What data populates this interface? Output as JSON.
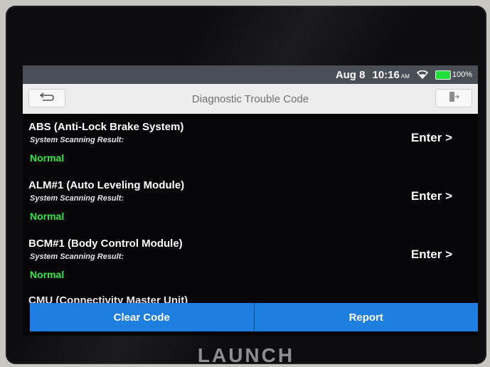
{
  "status": {
    "date": "Aug 8",
    "time": "10:16",
    "ampm": "AM",
    "battery": "100%",
    "wifi_icon": "wifi-icon",
    "battery_icon": "battery-icon"
  },
  "header": {
    "title": "Diagnostic Trouble Code",
    "back_icon": "back-arrow-icon",
    "exit_icon": "exit-icon"
  },
  "systems": [
    {
      "title": "ABS (Anti-Lock Brake System)",
      "subtitle": "System Scanning Result:",
      "result": "Normal",
      "action": "Enter >"
    },
    {
      "title": "ALM#1 (Auto Leveling Module)",
      "subtitle": "System Scanning Result:",
      "result": "Normal",
      "action": "Enter >"
    },
    {
      "title": "BCM#1 (Body Control Module)",
      "subtitle": "System Scanning Result:",
      "result": "Normal",
      "action": "Enter >"
    },
    {
      "title": "CMU (Connectivity Master Unit)"
    }
  ],
  "footer": {
    "clear_label": "Clear Code",
    "report_label": "Report"
  },
  "device": {
    "brand": "LAUNCH"
  },
  "colors": {
    "accent": "#1e7fe0",
    "normal": "#2fe83d"
  }
}
